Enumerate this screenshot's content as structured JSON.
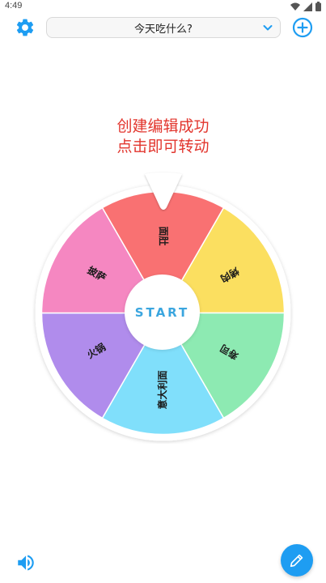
{
  "status_bar": {
    "time": "4:49"
  },
  "header": {
    "selector_value": "今天吃什么?"
  },
  "message": {
    "line1": "创建编辑成功",
    "line2": "点击即可转动"
  },
  "wheel": {
    "start_label": "START",
    "segments": [
      {
        "label": "面肚",
        "color": "#F97172"
      },
      {
        "label": "烤肉",
        "color": "#FBDF60"
      },
      {
        "label": "寿司",
        "color": "#8DEAB2"
      },
      {
        "label": "意大利面",
        "color": "#80DFFB"
      },
      {
        "label": "火锅",
        "color": "#B08CEC"
      },
      {
        "label": "披萨",
        "color": "#F587C1"
      }
    ]
  },
  "colors": {
    "accent": "#1E9DF2",
    "message": "#E2352D"
  },
  "icons": {
    "settings": "gear-icon",
    "add": "plus-circle-icon",
    "dropdown": "chevron-down-icon",
    "sound": "speaker-icon",
    "edit": "pencil-icon"
  }
}
